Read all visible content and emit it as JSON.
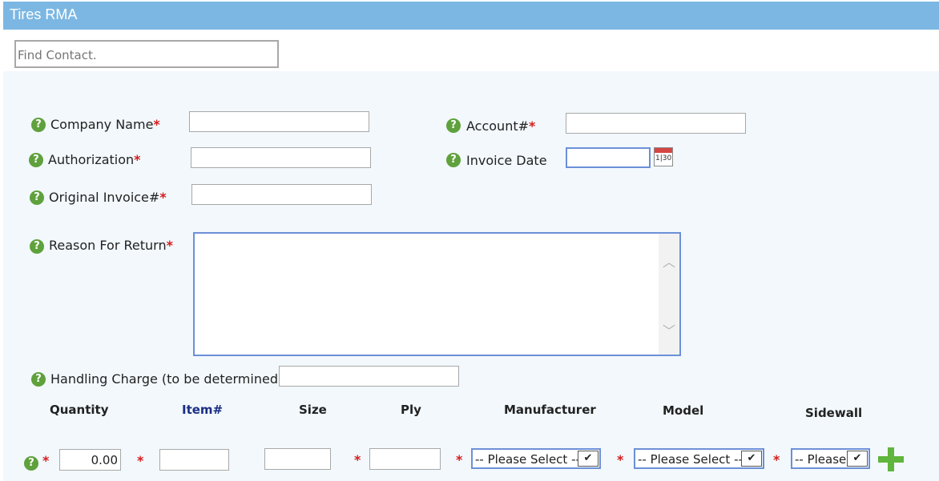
{
  "window": {
    "title": "Tires RMA"
  },
  "search": {
    "placeholder": "Find Contact."
  },
  "fields": {
    "company_name": "Company Name",
    "account": "Account#",
    "authorization": "Authorization",
    "invoice_date": "Invoice Date",
    "original_invoice": "Original Invoice#",
    "reason_for_return": "Reason For Return",
    "handling_charge": "Handling Charge (to be determined)",
    "required_mark": "*",
    "help_glyph": "?"
  },
  "icons": {
    "help": "help-icon",
    "calendar": "calendar-icon",
    "calendar_text": "1|30",
    "add": "add-row-icon"
  },
  "table": {
    "headers": [
      "Quantity",
      "Item#",
      "Size",
      "Ply",
      "Manufacturer",
      "Model",
      "Sidewall"
    ],
    "row": {
      "quantity": "0.00",
      "manufacturer_select": "-- Please Select --",
      "model_select": "-- Please Select --",
      "sidewall_select": "-- Please"
    },
    "dropdown_glyph": "✔"
  },
  "colors": {
    "title_bar": "#7cb7e3",
    "form_bg": "#f2f8fc",
    "required": "#d41c1c",
    "help_icon": "#5fa13c",
    "focus_border": "#6c90d8",
    "add_icon": "#5fb53d",
    "item_header": "#1b2f86"
  }
}
